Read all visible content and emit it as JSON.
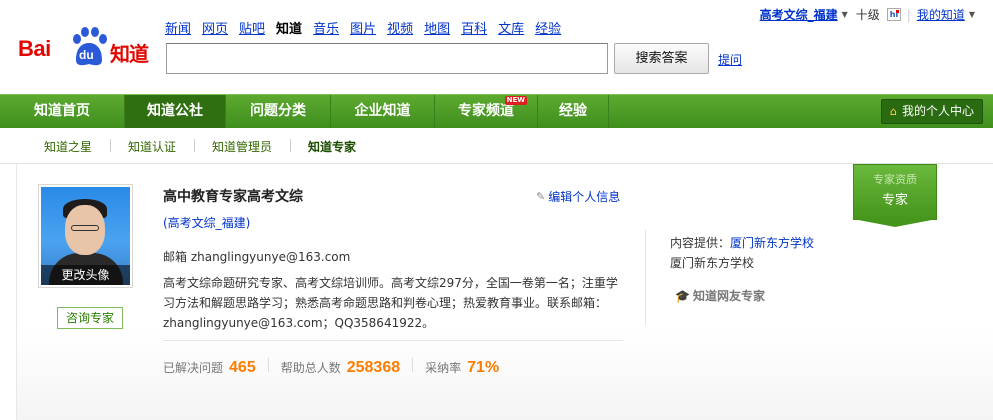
{
  "logo": {
    "text_bai": "Bai",
    "text_du": "du",
    "text_zhidao": "知道"
  },
  "top_links": [
    {
      "label": "新闻",
      "current": false
    },
    {
      "label": "网页",
      "current": false
    },
    {
      "label": "贴吧",
      "current": false
    },
    {
      "label": "知道",
      "current": true
    },
    {
      "label": "音乐",
      "current": false
    },
    {
      "label": "图片",
      "current": false
    },
    {
      "label": "视频",
      "current": false
    },
    {
      "label": "地图",
      "current": false
    },
    {
      "label": "百科",
      "current": false
    },
    {
      "label": "文库",
      "current": false
    },
    {
      "label": "经验",
      "current": false
    }
  ],
  "search": {
    "value": "",
    "button_label": "搜索答案",
    "ask_label": "提问"
  },
  "user": {
    "name": "高考文综_福建",
    "level": "十级",
    "hi_icon": "baidu-hi-icon",
    "my_zhidao": "我的知道"
  },
  "nav": {
    "items": [
      {
        "label": "知道首页",
        "active": false
      },
      {
        "label": "知道公社",
        "active": true
      },
      {
        "label": "问题分类",
        "active": false
      },
      {
        "label": "企业知道",
        "active": false
      },
      {
        "label": "专家频道",
        "active": false,
        "badge": "NEW"
      },
      {
        "label": "经验",
        "active": false
      }
    ],
    "personal_center": "我的个人中心"
  },
  "subnav": {
    "items": [
      {
        "label": "知道之星",
        "active": false
      },
      {
        "label": "知道认证",
        "active": false
      },
      {
        "label": "知道管理员",
        "active": false
      },
      {
        "label": "知道专家",
        "active": true
      }
    ]
  },
  "profile": {
    "avatar_caption": "更改头像",
    "consult_label": "咨询专家",
    "title": "高中教育专家高考文综",
    "edit_label": "编辑个人信息",
    "username_line": "(高考文综_福建)",
    "email_line": "邮箱 zhanglingyunye@163.com",
    "description": "高考文综命题研究专家、高考文综培训师。高考文综297分，全国一卷第一名；注重学习方法和解题思路学习；熟悉高考命题思路和判卷心理；热爱教育事业。联系邮箱：zhanglingyunye@163.com；QQ358641922。",
    "stats": [
      {
        "label": "已解决问题",
        "value": "465"
      },
      {
        "label": "帮助总人数",
        "value": "258368"
      },
      {
        "label": "采纳率",
        "value": "71%"
      }
    ],
    "provider_label": "内容提供：",
    "provider_link": "厦门新东方学校",
    "provider_name": "厦门新东方学校",
    "netfriend_label": "知道网友专家",
    "ribbon_line1": "专家资质",
    "ribbon_line2": "专家"
  },
  "colors": {
    "nav_green": "#4e9e28",
    "link_blue": "#0033cc",
    "accent_orange": "#ff7d00",
    "brand_red": "#e10602"
  }
}
